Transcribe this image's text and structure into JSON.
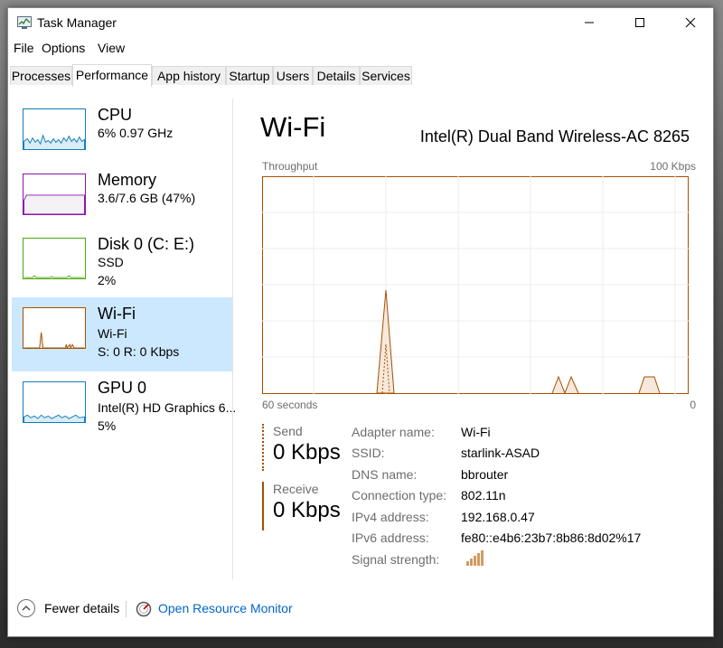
{
  "window": {
    "title": "Task Manager"
  },
  "menu": [
    "File",
    "Options",
    "View"
  ],
  "tabs": [
    "Processes",
    "Performance",
    "App history",
    "Startup",
    "Users",
    "Details",
    "Services"
  ],
  "active_tab": "Performance",
  "sidebar": {
    "items": [
      {
        "title": "CPU",
        "line1": "6%  0.97 GHz",
        "line2": "",
        "color": "#117dbb"
      },
      {
        "title": "Memory",
        "line1": "3.6/7.6 GB (47%)",
        "line2": "",
        "color": "#8b12ae"
      },
      {
        "title": "Disk 0 (C: E:)",
        "line1": "SSD",
        "line2": "2%",
        "color": "#4da60c"
      },
      {
        "title": "Wi-Fi",
        "line1": "Wi-Fi",
        "line2": "S: 0  R: 0 Kbps",
        "color": "#a74f01",
        "selected": true
      },
      {
        "title": "GPU 0",
        "line1": "Intel(R) HD Graphics 6...",
        "line2": "5%",
        "color": "#117dbb"
      }
    ]
  },
  "main": {
    "title": "Wi-Fi",
    "adapter": "Intel(R) Dual Band Wireless-AC 8265",
    "graph": {
      "label": "Throughput",
      "max_label": "100 Kbps",
      "time_label": "60 seconds",
      "min_label": "0",
      "color": "#a74f01"
    },
    "send": {
      "label": "Send",
      "value": "0 Kbps"
    },
    "receive": {
      "label": "Receive",
      "value": "0 Kbps"
    },
    "properties": [
      {
        "key": "Adapter name:",
        "value": "Wi-Fi"
      },
      {
        "key": "SSID:",
        "value": "starlink-ASAD"
      },
      {
        "key": "DNS name:",
        "value": "bbrouter"
      },
      {
        "key": "Connection type:",
        "value": "802.11n"
      },
      {
        "key": "IPv4 address:",
        "value": "192.168.0.47"
      },
      {
        "key": "IPv6 address:",
        "value": "fe80::e4b6:23b7:8b86:8d02%17"
      },
      {
        "key": "Signal strength:",
        "value": ""
      }
    ]
  },
  "footer": {
    "fewer_details": "Fewer details",
    "resource_monitor": "Open Resource Monitor"
  }
}
